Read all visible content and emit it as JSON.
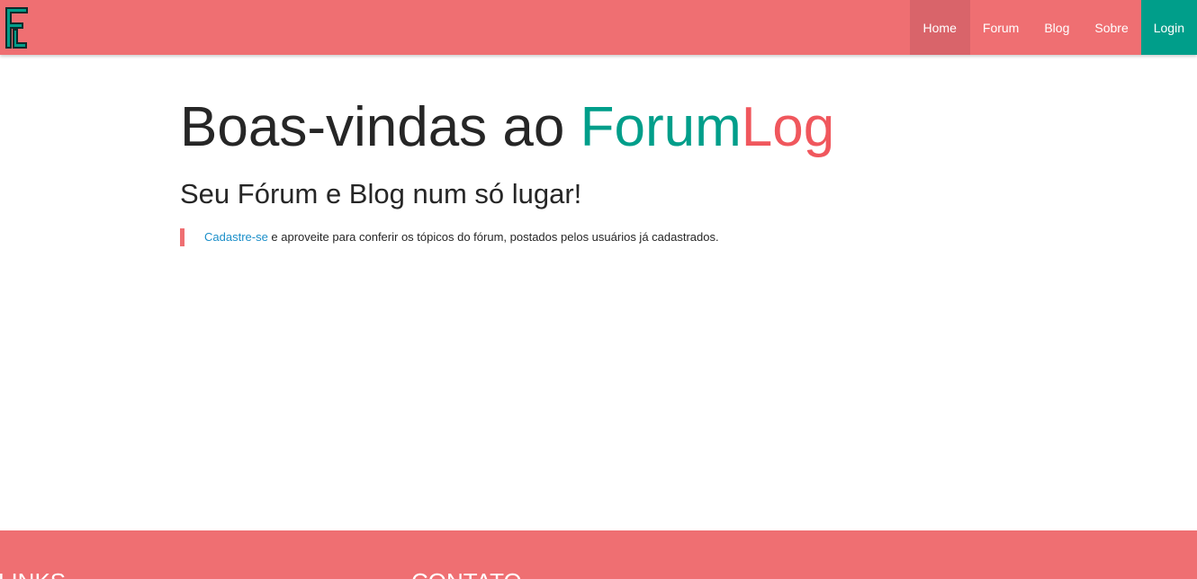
{
  "colors": {
    "primary": "#ef6f72",
    "accent": "#009e8a",
    "brand_log": "#f0575d",
    "link": "#1b8fc9",
    "active_nav": "#d9646a"
  },
  "navbar": {
    "logo_icon": "forumlog-logo-icon",
    "items": [
      {
        "label": "Home",
        "active": true
      },
      {
        "label": "Forum"
      },
      {
        "label": "Blog"
      },
      {
        "label": "Sobre"
      }
    ],
    "login_label": "Login"
  },
  "hero": {
    "title_prefix": "Boas-vindas ao ",
    "title_forum": "Forum",
    "title_log": "Log",
    "subtitle": "Seu Fórum e Blog num só lugar!",
    "quote_link": "Cadastre-se",
    "quote_text": " e aproveite para conferir os tópicos do fórum, postados pelos usuários já cadastrados."
  },
  "footer": {
    "links_heading": "LINKS",
    "contact_heading": "CONTATO"
  }
}
